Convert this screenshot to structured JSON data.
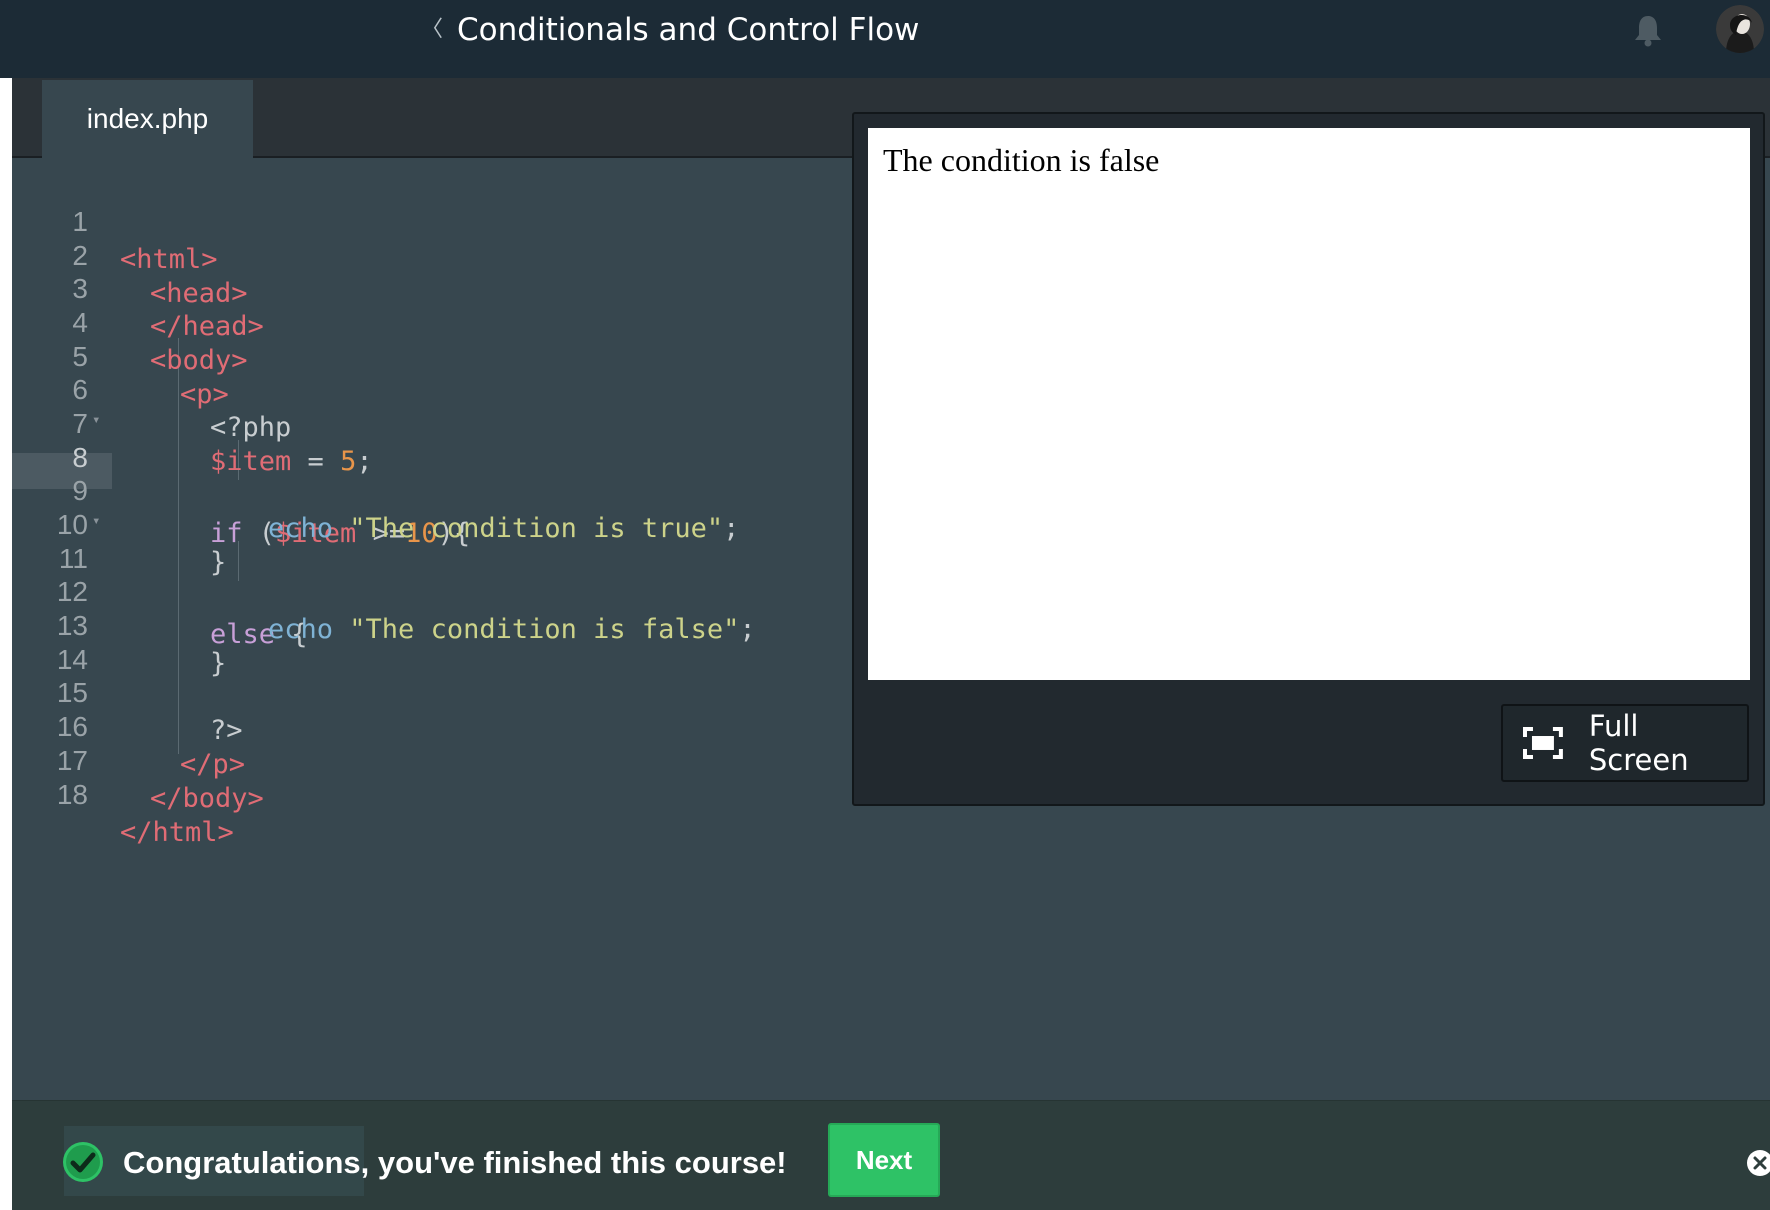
{
  "header": {
    "back_chevron": "〈",
    "course_title": "Conditionals and Control Flow",
    "notification_icon": "bell-icon",
    "avatar_icon": "user-avatar"
  },
  "editor": {
    "tab_label": "index.php",
    "active_line": 8,
    "line_numbers": [
      "1",
      "2",
      "3",
      "4",
      "5",
      "6",
      "7",
      "8",
      "9",
      "10",
      "11",
      "12",
      "13",
      "14",
      "15",
      "16",
      "17",
      "18"
    ],
    "lines": {
      "l1": "<html>",
      "l2": "<head>",
      "l3": "</head>",
      "l4": "<body>",
      "l5": "<p>",
      "l6": "<?php",
      "l7_var": "$item",
      "l7_op": " = ",
      "l7_num": "5",
      "l7_end": ";",
      "l8_kw": "if",
      "l8_paren": " (",
      "l8_var": "$item",
      "l8_op": " >=",
      "l8_num": "10",
      "l8_end": "){",
      "l9_fn": "echo",
      "l9_str": " \"The condition is true\"",
      "l9_end": ";",
      "l10": "}",
      "l11_kw": "else",
      "l11_end": " {",
      "l12_fn": "echo",
      "l12_str": " \"The condition is false\"",
      "l12_end": ";",
      "l13": "}",
      "l14": "",
      "l15": "?>",
      "l16": "</p>",
      "l17": "</body>",
      "l18": "</html>"
    }
  },
  "preview": {
    "output_text": "The condition is false",
    "fullscreen_label": "Full Screen"
  },
  "footer": {
    "message": "Congratulations, you've finished this course!",
    "next_label": "Next"
  },
  "colors": {
    "accent_green": "#2ec266",
    "topbar": "#1c2b36",
    "editor_bg": "#37474f"
  }
}
